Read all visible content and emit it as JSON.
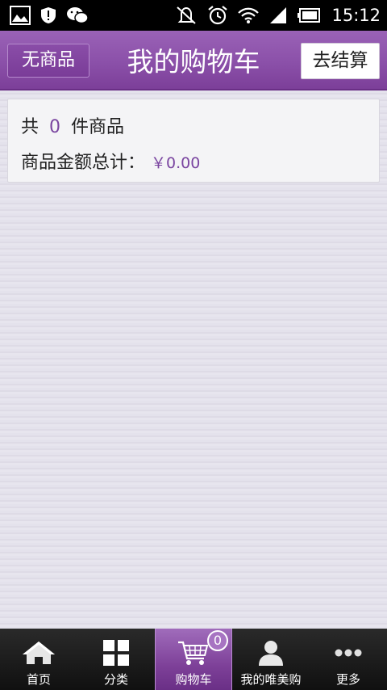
{
  "status_bar": {
    "time": "15:12",
    "left_icons": [
      "picture-icon",
      "shield-icon",
      "wechat-icon"
    ],
    "right_icons": [
      "vibrate-off-icon",
      "alarm-icon",
      "wifi-icon",
      "signal-icon",
      "battery-icon"
    ]
  },
  "header": {
    "left_button": "无商品",
    "title": "我的购物车",
    "right_button": "去结算"
  },
  "summary": {
    "count_prefix": "共",
    "count": "0",
    "count_suffix": "件商品",
    "total_label": "商品金额总计：",
    "total_value": "￥0.00"
  },
  "bottom_nav": {
    "items": [
      {
        "label": "首页",
        "icon": "home-icon"
      },
      {
        "label": "分类",
        "icon": "grid-icon"
      },
      {
        "label": "购物车",
        "icon": "cart-icon",
        "active": true,
        "badge": "0"
      },
      {
        "label": "我的唯美购",
        "icon": "user-icon"
      },
      {
        "label": "更多",
        "icon": "more-icon"
      }
    ]
  },
  "colors": {
    "accent": "#8b50a9",
    "price": "#7a45a0",
    "background": "#e4e2ec"
  }
}
